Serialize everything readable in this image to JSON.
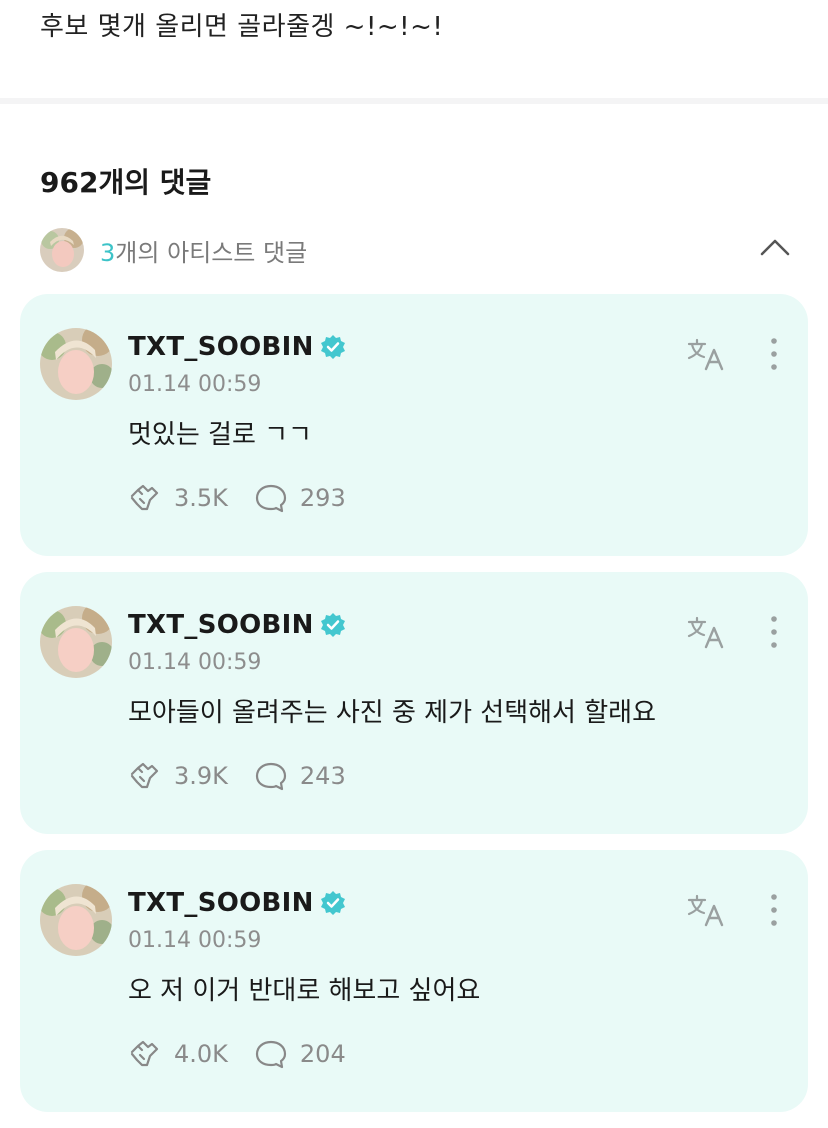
{
  "post": {
    "text": "후보 몇개 올리면 골라줄겡 ~!~!~!"
  },
  "comments_header": {
    "count_label": "962개의 댓글"
  },
  "artist_comments": {
    "count": "3",
    "label_suffix": "개의 아티스트 댓글",
    "collapse_icon": "chevron-up-icon"
  },
  "colors": {
    "card_bg": "#e9faf7",
    "accent": "#3cc3c8",
    "verified": "#43c7cf"
  },
  "comments": [
    {
      "username": "TXT_SOOBIN",
      "timestamp": "01.14 00:59",
      "text": "멋있는 걸로 ㄱㄱ",
      "likes": "3.5K",
      "replies": "293"
    },
    {
      "username": "TXT_SOOBIN",
      "timestamp": "01.14 00:59",
      "text": "모아들이 올려주는 사진 중 제가 선택해서 할래요",
      "likes": "3.9K",
      "replies": "243"
    },
    {
      "username": "TXT_SOOBIN",
      "timestamp": "01.14 00:59",
      "text": "오 저 이거 반대로 해보고 싶어요",
      "likes": "4.0K",
      "replies": "204"
    }
  ],
  "icons": {
    "like": "heart-hands-icon",
    "reply": "speech-bubble-icon",
    "translate": "translate-icon",
    "more": "more-vertical-icon",
    "verified": "verified-badge-icon"
  }
}
